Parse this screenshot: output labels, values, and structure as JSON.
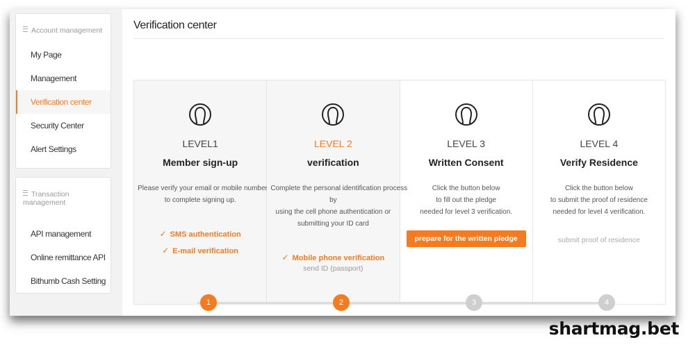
{
  "sidebar": {
    "section1": {
      "heading": "Account management",
      "items": [
        {
          "label": "My Page"
        },
        {
          "label": "Management"
        },
        {
          "label": "Verification center"
        },
        {
          "label": "Security Center"
        },
        {
          "label": "Alert Settings"
        }
      ]
    },
    "section2": {
      "heading": "Transaction management",
      "items": [
        {
          "label": "API management"
        },
        {
          "label": "Online remittance API"
        },
        {
          "label": "Bithumb Cash Setting"
        }
      ]
    }
  },
  "page": {
    "title": "Verification center"
  },
  "levels": [
    {
      "level": "LEVEL1",
      "name": "Member sign-up",
      "desc": [
        "Please verify your email or mobile number",
        "to complete signing up."
      ],
      "checks": [
        "SMS authentication",
        "E-mail verification"
      ],
      "step": "1"
    },
    {
      "level": "LEVEL 2",
      "name": "verification",
      "desc": [
        "Complete the personal identification process",
        "by",
        "using the cell phone authentication or",
        "submitting your ID card"
      ],
      "checks": [
        "Mobile phone verification"
      ],
      "pending": "send ID (passport)",
      "step": "2"
    },
    {
      "level": "LEVEL 3",
      "name": "Written Consent",
      "desc": [
        "Click the button below",
        "to fill out the pledge",
        "needed for level 3 verification."
      ],
      "button": "prepare for the written pledge",
      "step": "3"
    },
    {
      "level": "LEVEL 4",
      "name": "Verify Residence",
      "desc": [
        "Click the button below",
        "to submit the proof of residence",
        "needed for level 4 verification."
      ],
      "link": "submit proof of residence",
      "step": "4"
    }
  ],
  "watermark": "shartmag.bet",
  "colors": {
    "accent": "#f47b20",
    "inactive": "#cfcfcf"
  },
  "icons": {
    "level_icon": "user-profile-icon",
    "check": "check-icon"
  }
}
